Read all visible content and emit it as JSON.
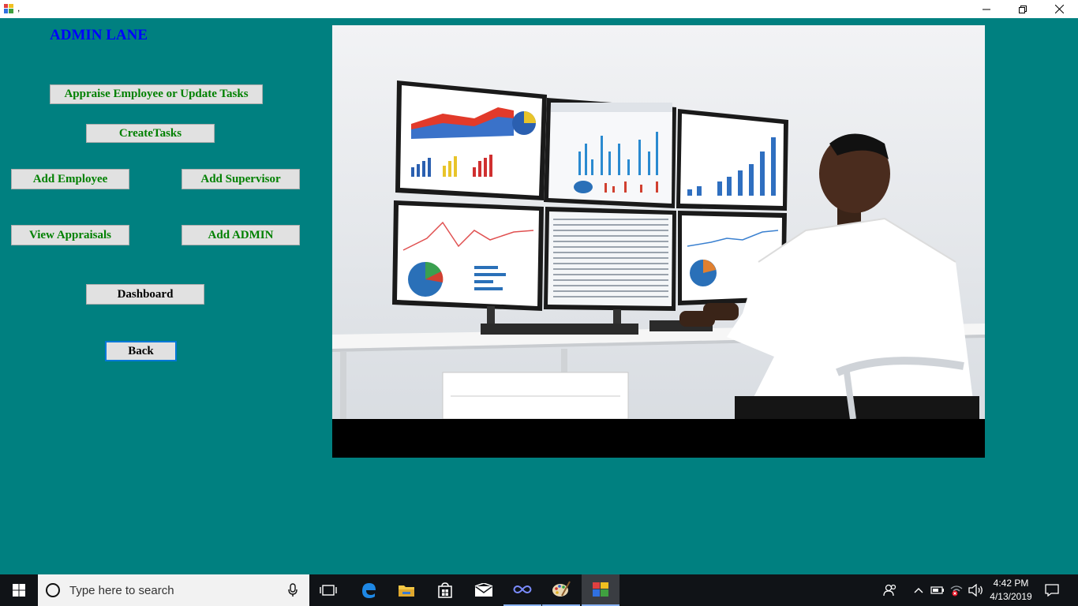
{
  "window": {
    "title": ",",
    "controls": [
      "minimize-icon",
      "restore-icon",
      "close-icon"
    ]
  },
  "form": {
    "heading": "ADMIN LANE",
    "buttons": {
      "appraise": "Appraise Employee or Update Tasks",
      "create_tasks": "CreateTasks",
      "add_employee": "Add Employee",
      "add_supervisor": "Add Supervisor",
      "view_appraisals": "View Appraisals",
      "add_admin": "Add ADMIN",
      "dashboard": "Dashboard",
      "back": "Back"
    },
    "colors": {
      "background": "#008080",
      "heading": "#0000ff",
      "button_text": "#008000"
    }
  },
  "taskbar": {
    "search_placeholder": "Type here to search",
    "time": "4:42 PM",
    "date": "4/13/2019",
    "pinned": [
      "task-view-icon",
      "edge-icon",
      "file-explorer-icon",
      "store-icon",
      "mail-icon",
      "infinity-app-icon",
      "paint-icon",
      "winforms-app-icon"
    ]
  }
}
